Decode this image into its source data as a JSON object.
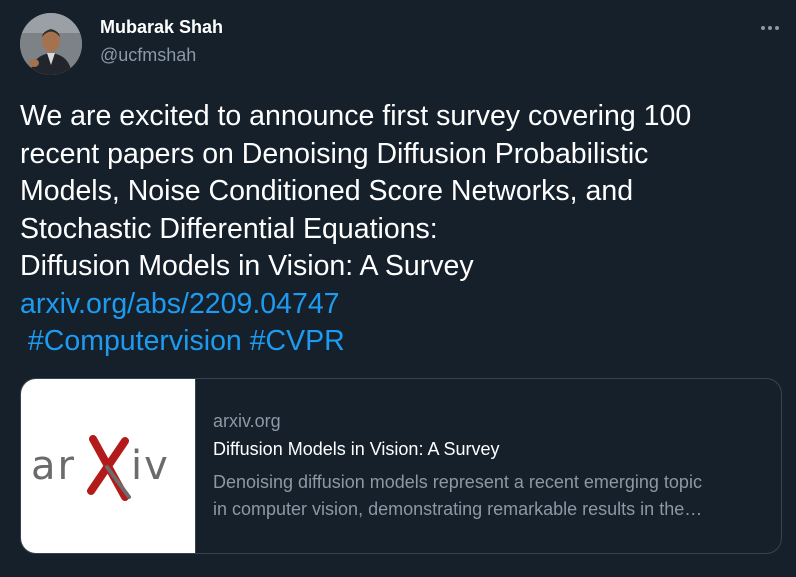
{
  "author": {
    "name": "Mubarak Shah",
    "handle": "@ucfmshah"
  },
  "more_icon": "more-horizontal-icon",
  "tweet": {
    "lines": [
      "We are excited to announce first survey covering 100",
      "recent papers on Denoising Diffusion Probabilistic",
      "Models, Noise Conditioned Score Networks, and",
      "Stochastic Differential Equations:",
      "Diffusion Models in Vision: A Survey"
    ],
    "link": "arxiv.org/abs/2209.04747",
    "hashtags": [
      "#Computervision",
      "#CVPR"
    ]
  },
  "card": {
    "domain": "arxiv.org",
    "title": "Diffusion Models in Vision: A Survey",
    "description_lines": [
      "Denoising diffusion models represent a recent emerging topic",
      "in computer vision, demonstrating remarkable results in the…"
    ],
    "logo_text": "arXiv"
  },
  "colors": {
    "background": "#15202b",
    "link": "#1d9bf0",
    "secondary_text": "#8b98a5",
    "border": "#38444d",
    "logo_red": "#b31b1b",
    "logo_gray": "#6c6a6a"
  }
}
